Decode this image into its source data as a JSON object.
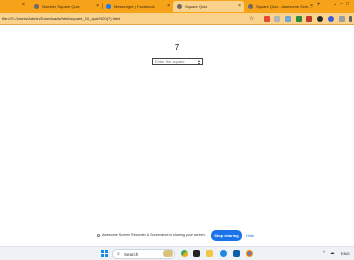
{
  "browser": {
    "tabs": [
      {
        "title": "Number Square Quiz",
        "active": false,
        "icon": "globe-icon"
      },
      {
        "title": "Messenger | Facebook",
        "active": false,
        "icon": "messenger-icon"
      },
      {
        "title": "Square Quiz",
        "active": true,
        "icon": "globe-icon"
      },
      {
        "title": "Square Quiz - Awesome Scre...",
        "active": false,
        "icon": "globe-icon"
      }
    ],
    "new_tab_label": "+",
    "close_glyph": "×",
    "window_controls": [
      "⌄",
      "–",
      "□",
      "×"
    ],
    "url": "file:///C:/Users/Admin/Downloads/html/square_10_quiz%20(7).html"
  },
  "page": {
    "number": "7",
    "answer_placeholder": "Enter the square",
    "answer_value": ""
  },
  "share_bar": {
    "message": "Awesome Screen Recorder & Screenshot is sharing your screen.",
    "stop_label": "Stop sharing",
    "hide_label": "Hide"
  },
  "taskbar": {
    "search_label": "Search",
    "language": "ENG",
    "tray_symbols": [
      "^",
      "☁",
      "🔊"
    ]
  },
  "colors": {
    "tabbar": "#f6a31a",
    "addressbar": "#fbd28b",
    "stop_button": "#1a73e8",
    "taskbar": "#eef1f5"
  }
}
